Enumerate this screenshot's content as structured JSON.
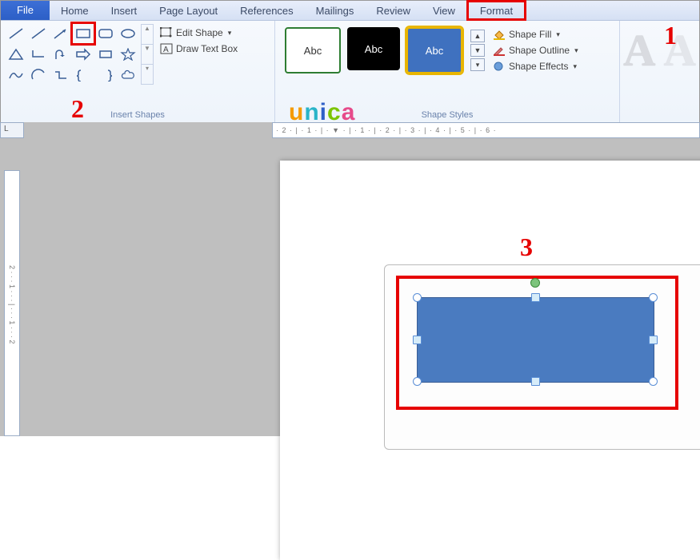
{
  "menu": {
    "file": "File",
    "home": "Home",
    "insert": "Insert",
    "page_layout": "Page Layout",
    "references": "References",
    "mailings": "Mailings",
    "review": "Review",
    "view": "View",
    "format": "Format"
  },
  "ribbon": {
    "edit_shape": "Edit Shape",
    "draw_text_box": "Draw Text Box",
    "insert_shapes": "Insert Shapes",
    "style_abc": "Abc",
    "shape_styles": "Shape Styles",
    "shape_fill": "Shape Fill",
    "shape_outline": "Shape Outline",
    "shape_effects": "Shape Effects"
  },
  "ruler": {
    "h": "· 2 · | · 1 · | · ▼ · | · 1 · | · 2 · | · 3 · | · 4 · | · 5 · | · 6 ·",
    "v": "2 · · · 1 · · · | · · · 1 · · · 2",
    "corner": "L"
  },
  "callouts": {
    "one": "1",
    "two": "2",
    "three": "3"
  },
  "watermark": {
    "u": "u",
    "n": "n",
    "i": "i",
    "c": "c",
    "a": "a"
  }
}
